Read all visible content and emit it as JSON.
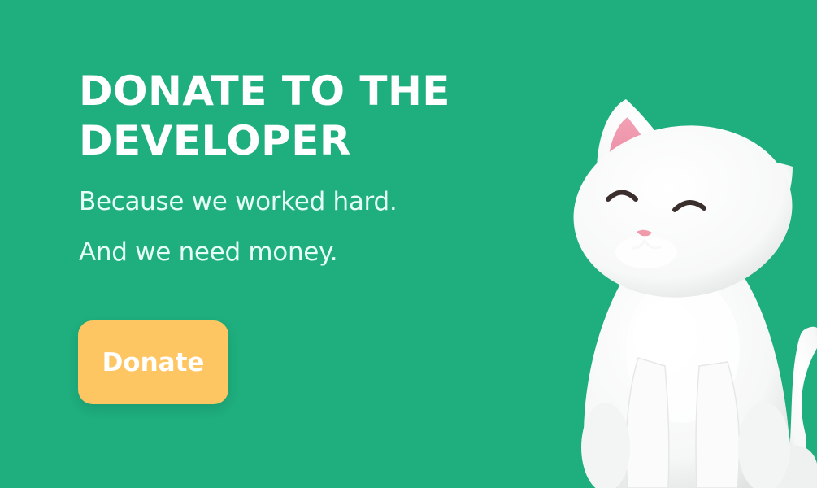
{
  "card": {
    "headline_line1": "DONATE TO THE",
    "headline_line2": "DEVELOPER",
    "tagline_1": "Because we worked hard.",
    "tagline_2": "And we need money.",
    "donate_label": "Donate"
  },
  "colors": {
    "background": "#1fae7e",
    "button": "#fdc662",
    "text": "#ffffff"
  },
  "illustration": {
    "icon": "white-cat-3d"
  }
}
